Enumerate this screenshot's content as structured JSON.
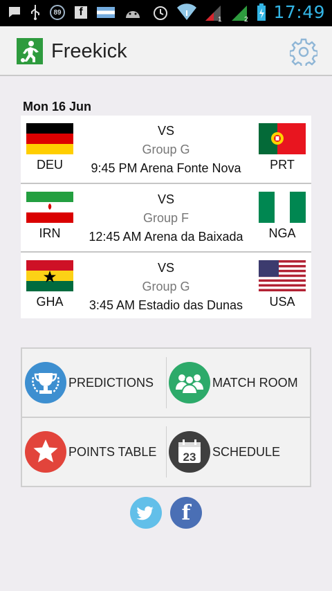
{
  "status_bar": {
    "time": "17:49",
    "notification_badge": "89",
    "icons": [
      "chat-icon",
      "usb-icon",
      "facebook-icon",
      "argentina-flag-icon",
      "android-icon",
      "alarm-icon",
      "wifi-icon",
      "signal-1-icon",
      "signal-2-icon",
      "battery-icon"
    ],
    "sim1": "1",
    "sim2": "2"
  },
  "app": {
    "title": "Freekick",
    "logo_icon": "soccer-player-icon",
    "settings_icon": "gear-icon",
    "accent": "#2e9b3e"
  },
  "date": "Mon 16 Jun",
  "matches": [
    {
      "home": "DEU",
      "away": "PRT",
      "vs": "VS",
      "group": "Group G",
      "venue": "9:45 PM Arena Fonte Nova",
      "home_flag": "germany-flag",
      "away_flag": "portugal-flag"
    },
    {
      "home": "IRN",
      "away": "NGA",
      "vs": "VS",
      "group": "Group F",
      "venue": "12:45 AM Arena da Baixada",
      "home_flag": "iran-flag",
      "away_flag": "nigeria-flag"
    },
    {
      "home": "GHA",
      "away": "USA",
      "vs": "VS",
      "group": "Group G",
      "venue": "3:45 AM Estadio das Dunas",
      "home_flag": "ghana-flag",
      "away_flag": "usa-flag"
    }
  ],
  "menu": {
    "predictions": "PREDICTIONS",
    "match_room": "MATCH ROOM",
    "points_table": "POINTS TABLE",
    "schedule": "SCHEDULE",
    "schedule_day": "23",
    "colors": {
      "predictions": "#3d8fd0",
      "match_room": "#2daa6a",
      "points_table": "#e2443b",
      "schedule": "#3f3f3f"
    }
  },
  "social": {
    "twitter_icon": "twitter-icon",
    "facebook_icon": "facebook-icon",
    "facebook_glyph": "f"
  }
}
